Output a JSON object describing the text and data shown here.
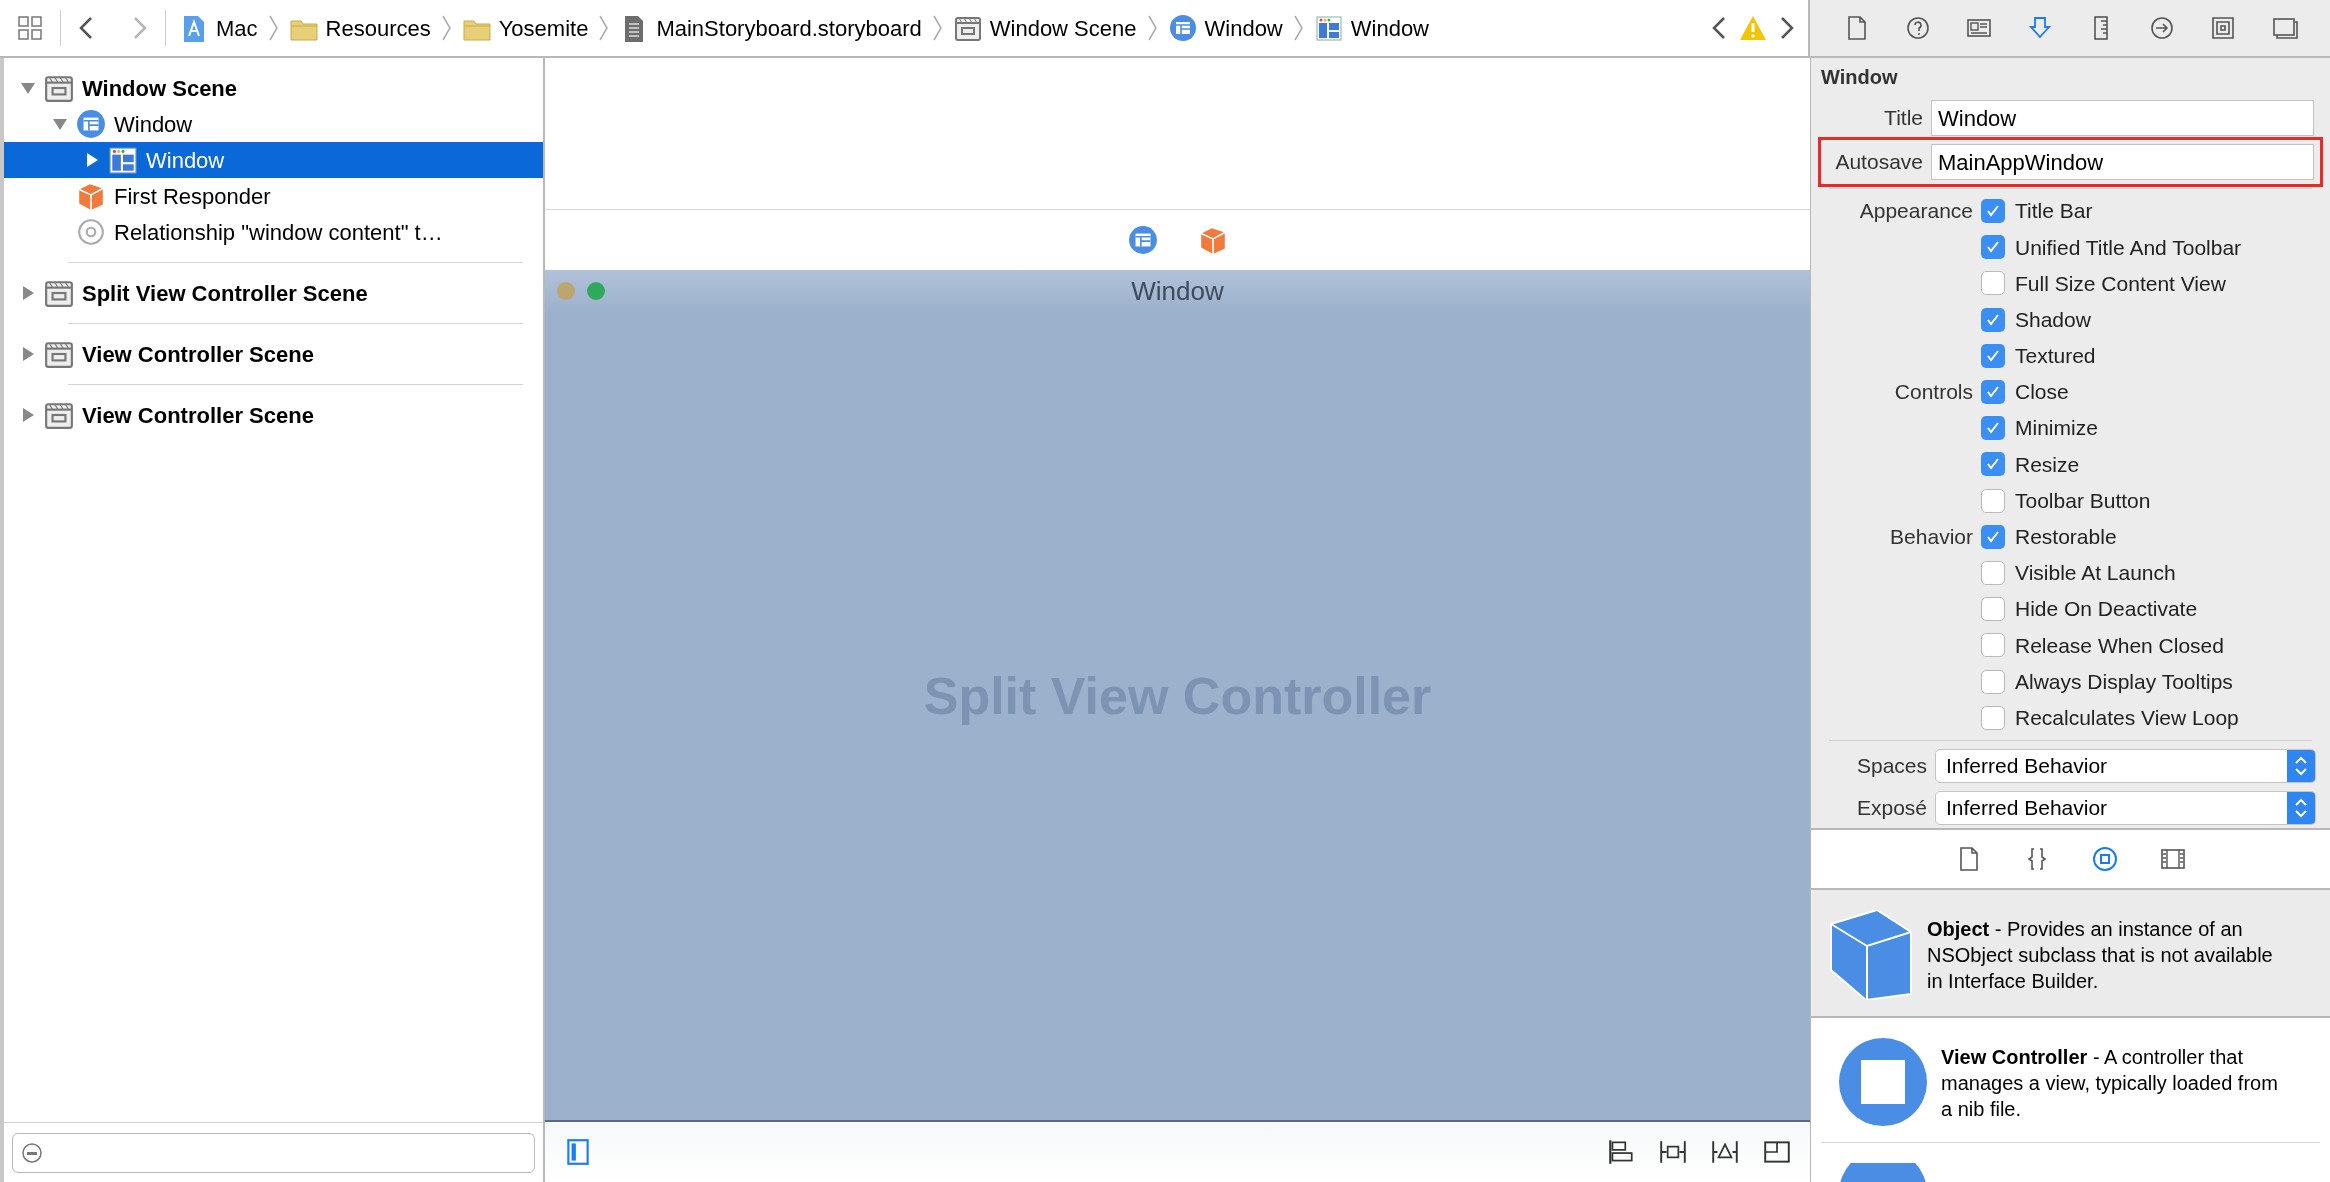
{
  "jump_bar": {
    "nav": [
      {
        "kind": "back",
        "disabled": false
      },
      {
        "kind": "forward",
        "disabled": true
      }
    ],
    "breadcrumbs": [
      {
        "label": "Mac",
        "kind": "app"
      },
      {
        "label": "Resources",
        "kind": "folder"
      },
      {
        "label": "Yosemite",
        "kind": "folder"
      },
      {
        "label": "MainStoryboard.storyboard",
        "kind": "storyboard"
      },
      {
        "label": "Window Scene",
        "kind": "scene"
      },
      {
        "label": "Window",
        "kind": "controller"
      },
      {
        "label": "Window",
        "kind": "window"
      }
    ],
    "issues": {
      "kind": "warning"
    }
  },
  "inspector_tabs": [
    {
      "kind": "file",
      "selected": false
    },
    {
      "kind": "help",
      "selected": false
    },
    {
      "kind": "identity",
      "selected": false
    },
    {
      "kind": "attributes",
      "selected": true
    },
    {
      "kind": "size",
      "selected": false
    },
    {
      "kind": "connections",
      "selected": false
    },
    {
      "kind": "bindings",
      "selected": false
    },
    {
      "kind": "effects",
      "selected": false
    }
  ],
  "outline": [
    {
      "label": "Window Scene",
      "kind": "scene",
      "expanded": true,
      "selected": false,
      "children": [
        {
          "label": "Window",
          "kind": "controller",
          "expanded": true,
          "selected": false,
          "children": [
            {
              "label": "Window",
              "kind": "window",
              "expanded": false,
              "selected": true
            }
          ]
        },
        {
          "label": "First Responder",
          "kind": "responder",
          "selected": false
        },
        {
          "label": "Relationship \"window content\" t…",
          "kind": "relationship",
          "selected": false
        }
      ]
    },
    {
      "label": "Split View Controller Scene",
      "kind": "scene",
      "expanded": false,
      "selected": false
    },
    {
      "label": "View Controller Scene",
      "kind": "scene",
      "expanded": false,
      "selected": false
    },
    {
      "label": "View Controller Scene",
      "kind": "scene",
      "expanded": false,
      "selected": false
    }
  ],
  "canvas": {
    "scene_dock": [
      {
        "kind": "controller"
      },
      {
        "kind": "responder"
      }
    ],
    "window_title": "Window",
    "placeholder": "Split View Controller",
    "bottom_tools": [
      {
        "kind": "outline-toggle",
        "selected": true
      },
      {
        "kind": "align",
        "selected": false
      },
      {
        "kind": "pin",
        "selected": false
      },
      {
        "kind": "resolve",
        "selected": false
      },
      {
        "kind": "resizing",
        "selected": false
      }
    ]
  },
  "inspector": {
    "section_title": "Window",
    "fields": [
      {
        "label": "Title",
        "value": "Window",
        "highlighted": false
      },
      {
        "label": "Autosave",
        "value": "MainAppWindow",
        "highlighted": true
      }
    ],
    "checkbox_groups": [
      {
        "label": "Appearance",
        "options": [
          {
            "label": "Title Bar",
            "checked": true
          },
          {
            "label": "Unified Title And Toolbar",
            "checked": true
          },
          {
            "label": "Full Size Content View",
            "checked": false
          },
          {
            "label": "Shadow",
            "checked": true
          },
          {
            "label": "Textured",
            "checked": true
          }
        ]
      },
      {
        "label": "Controls",
        "options": [
          {
            "label": "Close",
            "checked": true
          },
          {
            "label": "Minimize",
            "checked": true
          },
          {
            "label": "Resize",
            "checked": true
          },
          {
            "label": "Toolbar Button",
            "checked": false
          }
        ]
      },
      {
        "label": "Behavior",
        "options": [
          {
            "label": "Restorable",
            "checked": true
          },
          {
            "label": "Visible At Launch",
            "checked": false
          },
          {
            "label": "Hide On Deactivate",
            "checked": false
          },
          {
            "label": "Release When Closed",
            "checked": false
          },
          {
            "label": "Always Display Tooltips",
            "checked": false
          },
          {
            "label": "Recalculates View Loop",
            "checked": false
          }
        ]
      }
    ],
    "popups": [
      {
        "label": "Spaces",
        "value": "Inferred Behavior"
      },
      {
        "label": "Exposé",
        "value": "Inferred Behavior"
      }
    ]
  },
  "library_tabs": [
    {
      "kind": "file",
      "selected": false
    },
    {
      "kind": "code",
      "selected": false
    },
    {
      "kind": "object",
      "selected": true
    },
    {
      "kind": "media",
      "selected": false
    }
  ],
  "library": [
    {
      "kind": "cube",
      "text": "**Object** - Provides an instance of an NSObject subclass that is not available in Interface Builder.",
      "selected": true
    },
    {
      "kind": "controller",
      "text": "**View Controller** - A controller that manages a view, typically loaded from a nib file.",
      "selected": false
    },
    {
      "kind": "partial",
      "selected": false
    }
  ]
}
